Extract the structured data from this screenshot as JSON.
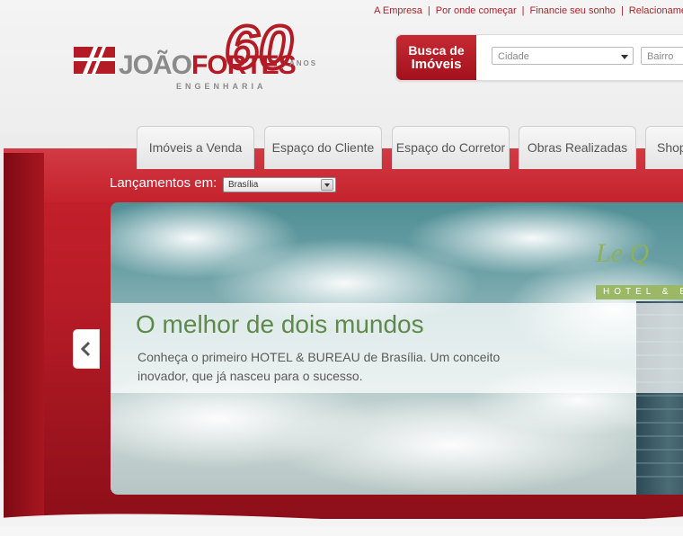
{
  "top_links": [
    "A Empresa",
    "Por onde começar",
    "Financie seu sonho",
    "Relacioname"
  ],
  "logo": {
    "name_part1": "JOÃO",
    "name_part2": "FORTES",
    "sub": "ENGENHARIA",
    "anniversary": "60",
    "anos": "ANOS"
  },
  "search": {
    "tab_line1": "Busca de",
    "tab_line2": "Imóveis",
    "cidade": "Cidade",
    "bairro": "Bairro"
  },
  "nav": {
    "tabs": [
      "Imóveis a Venda",
      "Espaço do Cliente",
      "Espaço do Corretor",
      "Obras Realizadas",
      "Shop"
    ]
  },
  "launches": {
    "label": "Lançamentos em:",
    "city": "Brasília"
  },
  "banner": {
    "title": "O melhor de dois mundos",
    "text": "Conheça o primeiro HOTEL & BUREAU de Brasília. Um conceito inovador, que já nasceu para o sucesso.",
    "hotel_logo": "Le Q",
    "hotel_bar": "HOTEL & B"
  },
  "colors": {
    "brand_red": "#b31b25",
    "caption_green": "#5d8a4a"
  }
}
